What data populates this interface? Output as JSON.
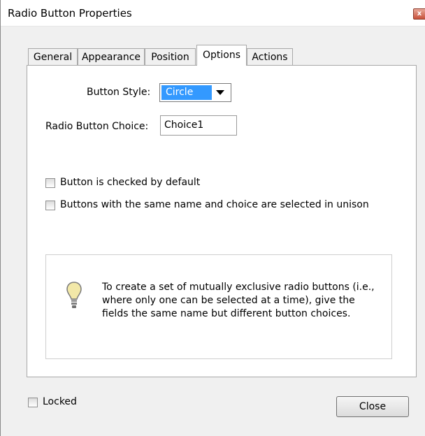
{
  "window": {
    "title": "Radio Button Properties",
    "close_glyph": "x"
  },
  "tabs": [
    {
      "label": "General",
      "active": false
    },
    {
      "label": "Appearance",
      "active": false
    },
    {
      "label": "Position",
      "active": false
    },
    {
      "label": "Options",
      "active": true
    },
    {
      "label": "Actions",
      "active": false
    }
  ],
  "options": {
    "button_style": {
      "label": "Button Style:",
      "value": "Circle"
    },
    "radio_button_choice": {
      "label": "Radio Button Choice:",
      "value": "Choice1"
    },
    "checked_by_default": {
      "label": "Button is checked by default",
      "checked": false
    },
    "select_in_unison": {
      "label": "Buttons with the same name and choice are selected in unison",
      "checked": false
    },
    "tip": {
      "icon": "lightbulb-icon",
      "text": "To create a set of mutually exclusive radio buttons (i.e., where only one can be selected at a time), give the fields the same name but different button choices."
    }
  },
  "footer": {
    "locked": {
      "label": "Locked",
      "checked": false
    },
    "close_label": "Close"
  },
  "colors": {
    "selection": "#3399ff",
    "dialog_bg": "#f0f0f0",
    "panel_bg": "#ffffff",
    "bulb": "#f2e8a8"
  }
}
